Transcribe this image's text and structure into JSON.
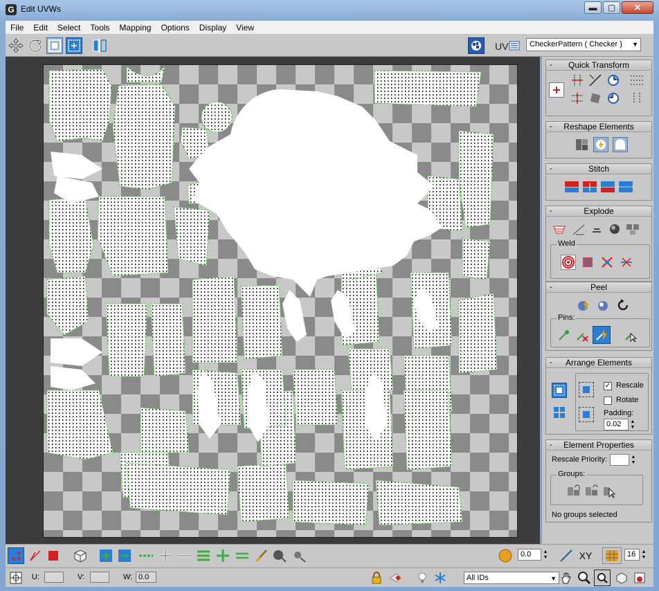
{
  "window": {
    "title": "Edit UVWs",
    "app_icon": "G",
    "minimize": "▬",
    "maximize": "▢",
    "close": "✕"
  },
  "menubar": {
    "items": [
      "File",
      "Edit",
      "Select",
      "Tools",
      "Mapping",
      "Options",
      "Display",
      "View"
    ]
  },
  "toolbar": {
    "tools": [
      "move-icon",
      "rotate-icon",
      "scale-icon",
      "freeform-icon",
      "mirror-icon"
    ],
    "uv_label": "UV",
    "texture_dropdown": "CheckerPattern  ( Checker )"
  },
  "panels": {
    "quick_transform": {
      "title": "Quick Transform"
    },
    "reshape_elements": {
      "title": "Reshape Elements"
    },
    "stitch": {
      "title": "Stitch"
    },
    "explode": {
      "title": "Explode",
      "weld_label": "Weld"
    },
    "peel": {
      "title": "Peel",
      "pins_label": "Pins:"
    },
    "arrange_elements": {
      "title": "Arrange Elements",
      "rescale_label": "Rescale",
      "rescale_checked": true,
      "rotate_label": "Rotate",
      "rotate_checked": false,
      "padding_label": "Padding:",
      "padding_value": "0.02"
    },
    "element_properties": {
      "title": "Element Properties",
      "rescale_priority_label": "Rescale Priority:",
      "rescale_priority_value": "",
      "groups_label": "Groups:",
      "status": "No groups selected"
    }
  },
  "bottombar": {
    "soft_value": "0.0",
    "xy_label": "XY",
    "grid_value": "16"
  },
  "statusbar": {
    "u_label": "U:",
    "v_label": "V:",
    "w_label": "W:",
    "u_value": "",
    "v_value": "",
    "w_value": "0.0",
    "ids_dropdown": "All IDs"
  },
  "colors": {
    "selection_green": "#50d040",
    "checker_light": "#c8c8c8",
    "checker_dark": "#8a8a8a",
    "uv_white": "#ffffff",
    "accent_blue": "#2a7fd4",
    "titlebar_blue": "#86aad6"
  }
}
